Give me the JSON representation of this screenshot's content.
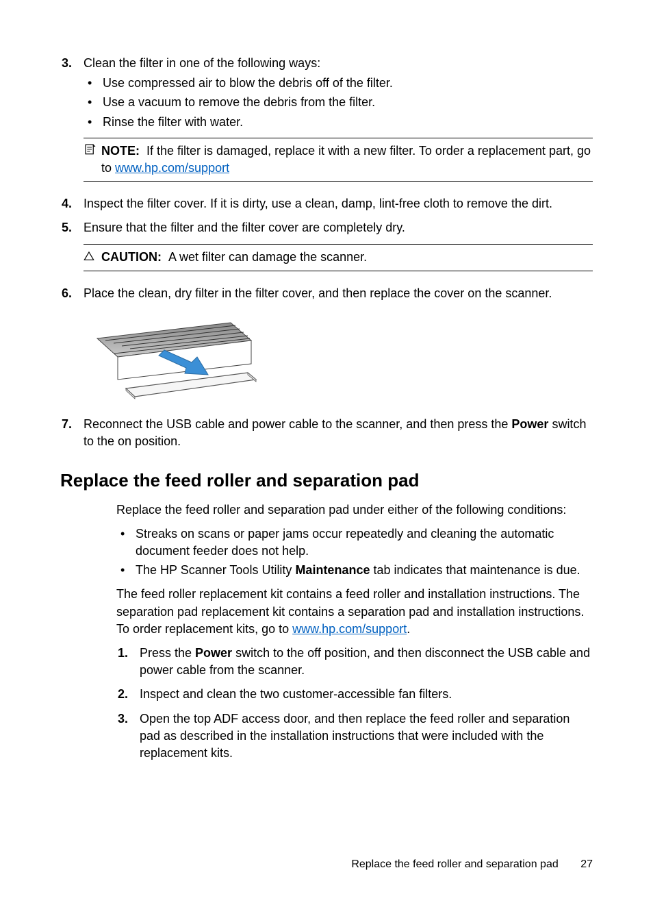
{
  "step3": {
    "num": "3.",
    "text": "Clean the filter in one of the following ways:",
    "bullets": [
      "Use compressed air to blow the debris off of the filter.",
      "Use a vacuum to remove the debris from the filter.",
      "Rinse the filter with water."
    ],
    "note_label": "NOTE:",
    "note_before": "If the filter is damaged, replace it with a new filter. To order a replacement part, go to ",
    "note_link": "www.hp.com/support"
  },
  "step4": {
    "num": "4.",
    "text": "Inspect the filter cover. If it is dirty, use a clean, damp, lint-free cloth to remove the dirt."
  },
  "step5": {
    "num": "5.",
    "text": "Ensure that the filter and the filter cover are completely dry.",
    "caution_label": "CAUTION:",
    "caution_text": "A wet filter can damage the scanner."
  },
  "step6": {
    "num": "6.",
    "text": "Place the clean, dry filter in the filter cover, and then replace the cover on the scanner."
  },
  "step7": {
    "num": "7.",
    "before": "Reconnect the USB cable and power cable to the scanner, and then press the ",
    "bold": "Power",
    "after": " switch to the on position."
  },
  "section": {
    "heading": "Replace the feed roller and separation pad",
    "intro": "Replace the feed roller and separation pad under either of the following conditions:",
    "bullets": [
      {
        "text": "Streaks on scans or paper jams occur repeatedly and cleaning the automatic document feeder does not help."
      },
      {
        "before": "The HP Scanner Tools Utility ",
        "bold": "Maintenance",
        "after": " tab indicates that maintenance is due."
      }
    ],
    "para_before": "The feed roller replacement kit contains a feed roller and installation instructions. The separation pad replacement kit contains a separation pad and installation instructions. To order replacement kits, go to ",
    "para_link": "www.hp.com/support",
    "para_after": ".",
    "steps": [
      {
        "num": "1.",
        "before": "Press the ",
        "bold": "Power",
        "after": " switch to the off position, and then disconnect the USB cable and power cable from the scanner."
      },
      {
        "num": "2.",
        "text": "Inspect and clean the two customer-accessible fan filters."
      },
      {
        "num": "3.",
        "text": "Open the top ADF access door, and then replace the feed roller and separation pad as described in the installation instructions that were included with the replacement kits."
      }
    ]
  },
  "footer": {
    "title": "Replace the feed roller and separation pad",
    "page": "27"
  }
}
